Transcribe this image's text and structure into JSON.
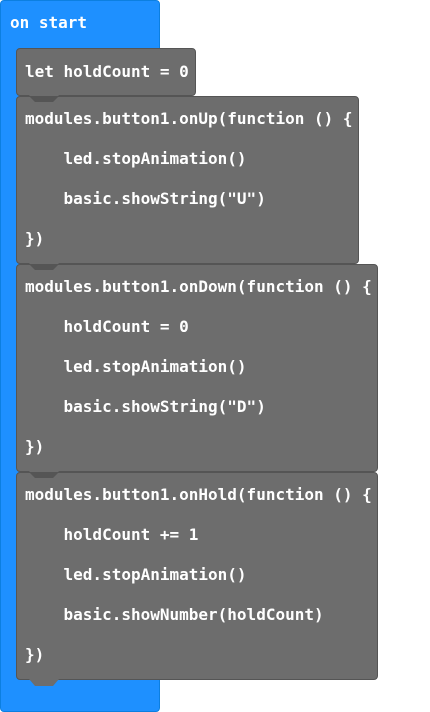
{
  "event": {
    "label": "on start"
  },
  "blocks": [
    {
      "lines": [
        "let holdCount = 0"
      ]
    },
    {
      "lines": [
        "modules.button1.onUp(function () {",
        "    led.stopAnimation()",
        "    basic.showString(\"U\")",
        "})"
      ]
    },
    {
      "lines": [
        "modules.button1.onDown(function () {",
        "    holdCount = 0",
        "    led.stopAnimation()",
        "    basic.showString(\"D\")",
        "})"
      ]
    },
    {
      "lines": [
        "modules.button1.onHold(function () {",
        "    holdCount += 1",
        "    led.stopAnimation()",
        "    basic.showNumber(holdCount)",
        "})"
      ]
    }
  ],
  "colors": {
    "event_block": "#1e90ff",
    "statement_block": "#6d6d6d",
    "text": "#ffffff"
  }
}
